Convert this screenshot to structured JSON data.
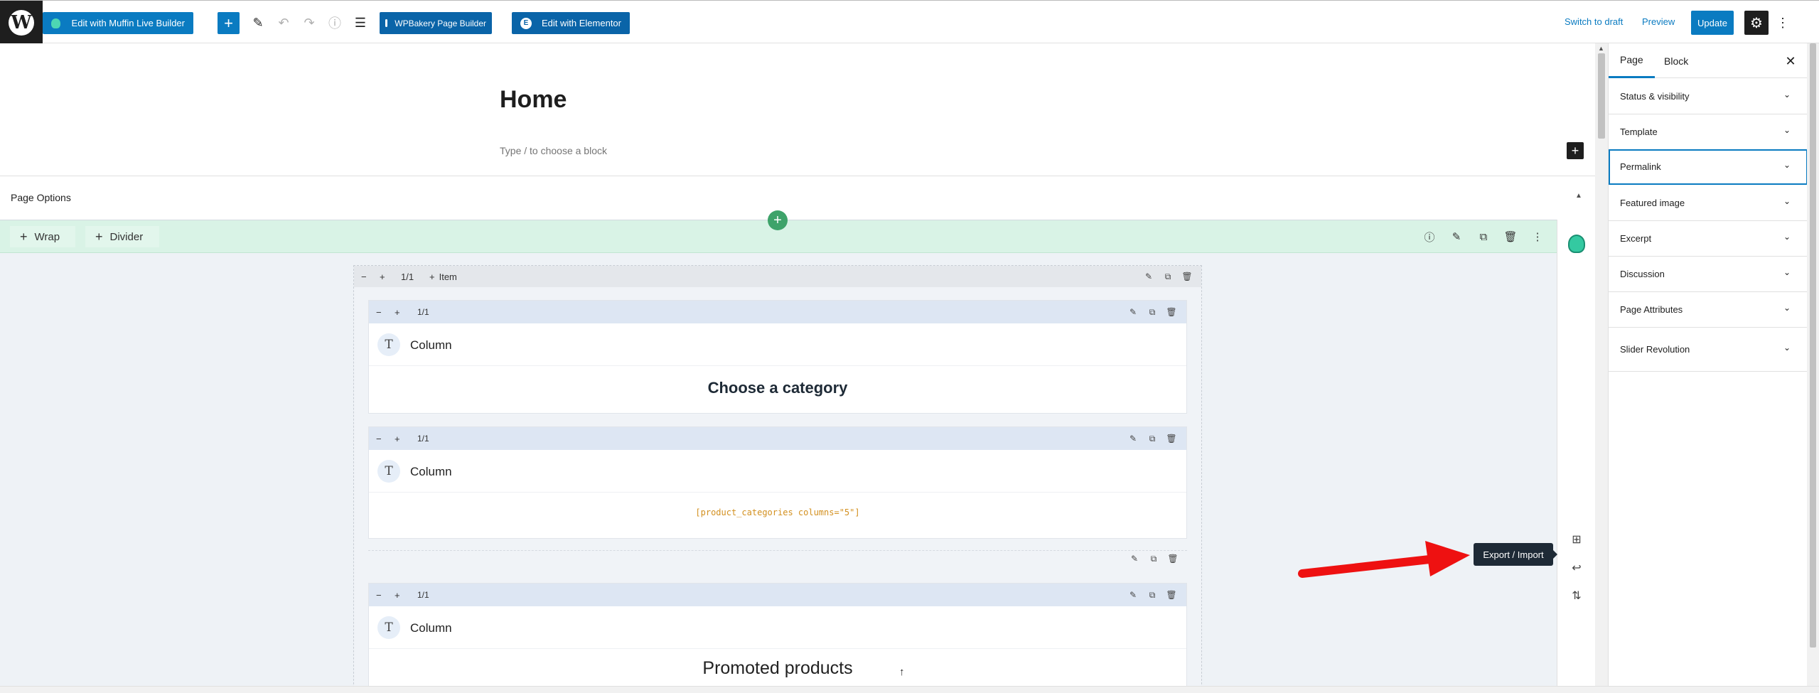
{
  "toolbar": {
    "muffin_label": "Edit with Muffin Live Builder",
    "wpbakery_label": "WPBakery Page Builder",
    "elementor_label": "Edit with Elementor",
    "switch_draft": "Switch to draft",
    "preview": "Preview",
    "update": "Update",
    "add_icon": "+",
    "more_icon": "⋮"
  },
  "editor": {
    "title": "Home",
    "placeholder": "Type / to choose a block",
    "page_options": "Page Options"
  },
  "builder": {
    "wrap_btn": "Wrap",
    "divider_btn": "Divider",
    "wrap_size": "1/1",
    "add_item": "Item",
    "items": [
      {
        "size": "1/1",
        "label": "Column",
        "content": "Choose a category"
      },
      {
        "size": "1/1",
        "label": "Column",
        "content": "[product_categories columns=\"5\"]"
      },
      {
        "size": "1/1",
        "label": "Column",
        "content": "Promoted products"
      }
    ]
  },
  "tooltip": "Export / Import",
  "sidebar": {
    "tabs": [
      "Page",
      "Block"
    ],
    "active_tab": "Page",
    "panels": [
      "Status & visibility",
      "Template",
      "Permalink",
      "Featured image",
      "Excerpt",
      "Discussion",
      "Page Attributes",
      "Slider Revolution"
    ],
    "active_panel": "Permalink"
  },
  "colors": {
    "accent": "#0a7bc1",
    "section_bar": "#d9f3e6",
    "add_section": "#3ea36a",
    "arrow": "#ee1111",
    "shortcode": "#d3901f"
  }
}
